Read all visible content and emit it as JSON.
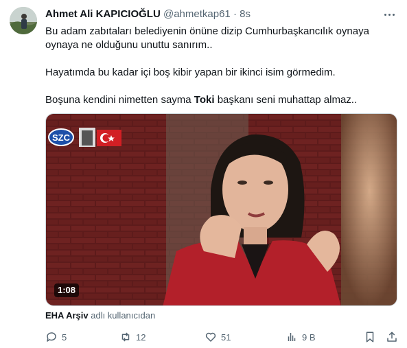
{
  "author": {
    "name": "Ahmet Ali KAPICIOĞLU",
    "handle": "@ahmetkap61",
    "separator": "·",
    "time": "8s"
  },
  "tweet": {
    "para1": "Bu adam zabıtaları belediyenin önüne dizip Cumhurbaşkancılık oynaya oynaya ne olduğunu unuttu sanırım..",
    "para2": "Hayatımda bu kadar içi boş kibir yapan bir ikinci isim görmedim.",
    "para3_before": "Boşuna kendini nimetten sayma ",
    "para3_bold": "Toki",
    "para3_after": " başkanı seni muhattap almaz.."
  },
  "video": {
    "duration": "1:08",
    "channel_logo": "SZC"
  },
  "attribution": {
    "source": "EHA Arşiv",
    "suffix": " adlı kullanıcıdan"
  },
  "actions": {
    "replies": "5",
    "retweets": "12",
    "likes": "51",
    "views": "9 B"
  },
  "colors": {
    "text": "#0f1419",
    "muted": "#536471",
    "brick": "#8a2a2a",
    "jacket": "#b3202a"
  }
}
